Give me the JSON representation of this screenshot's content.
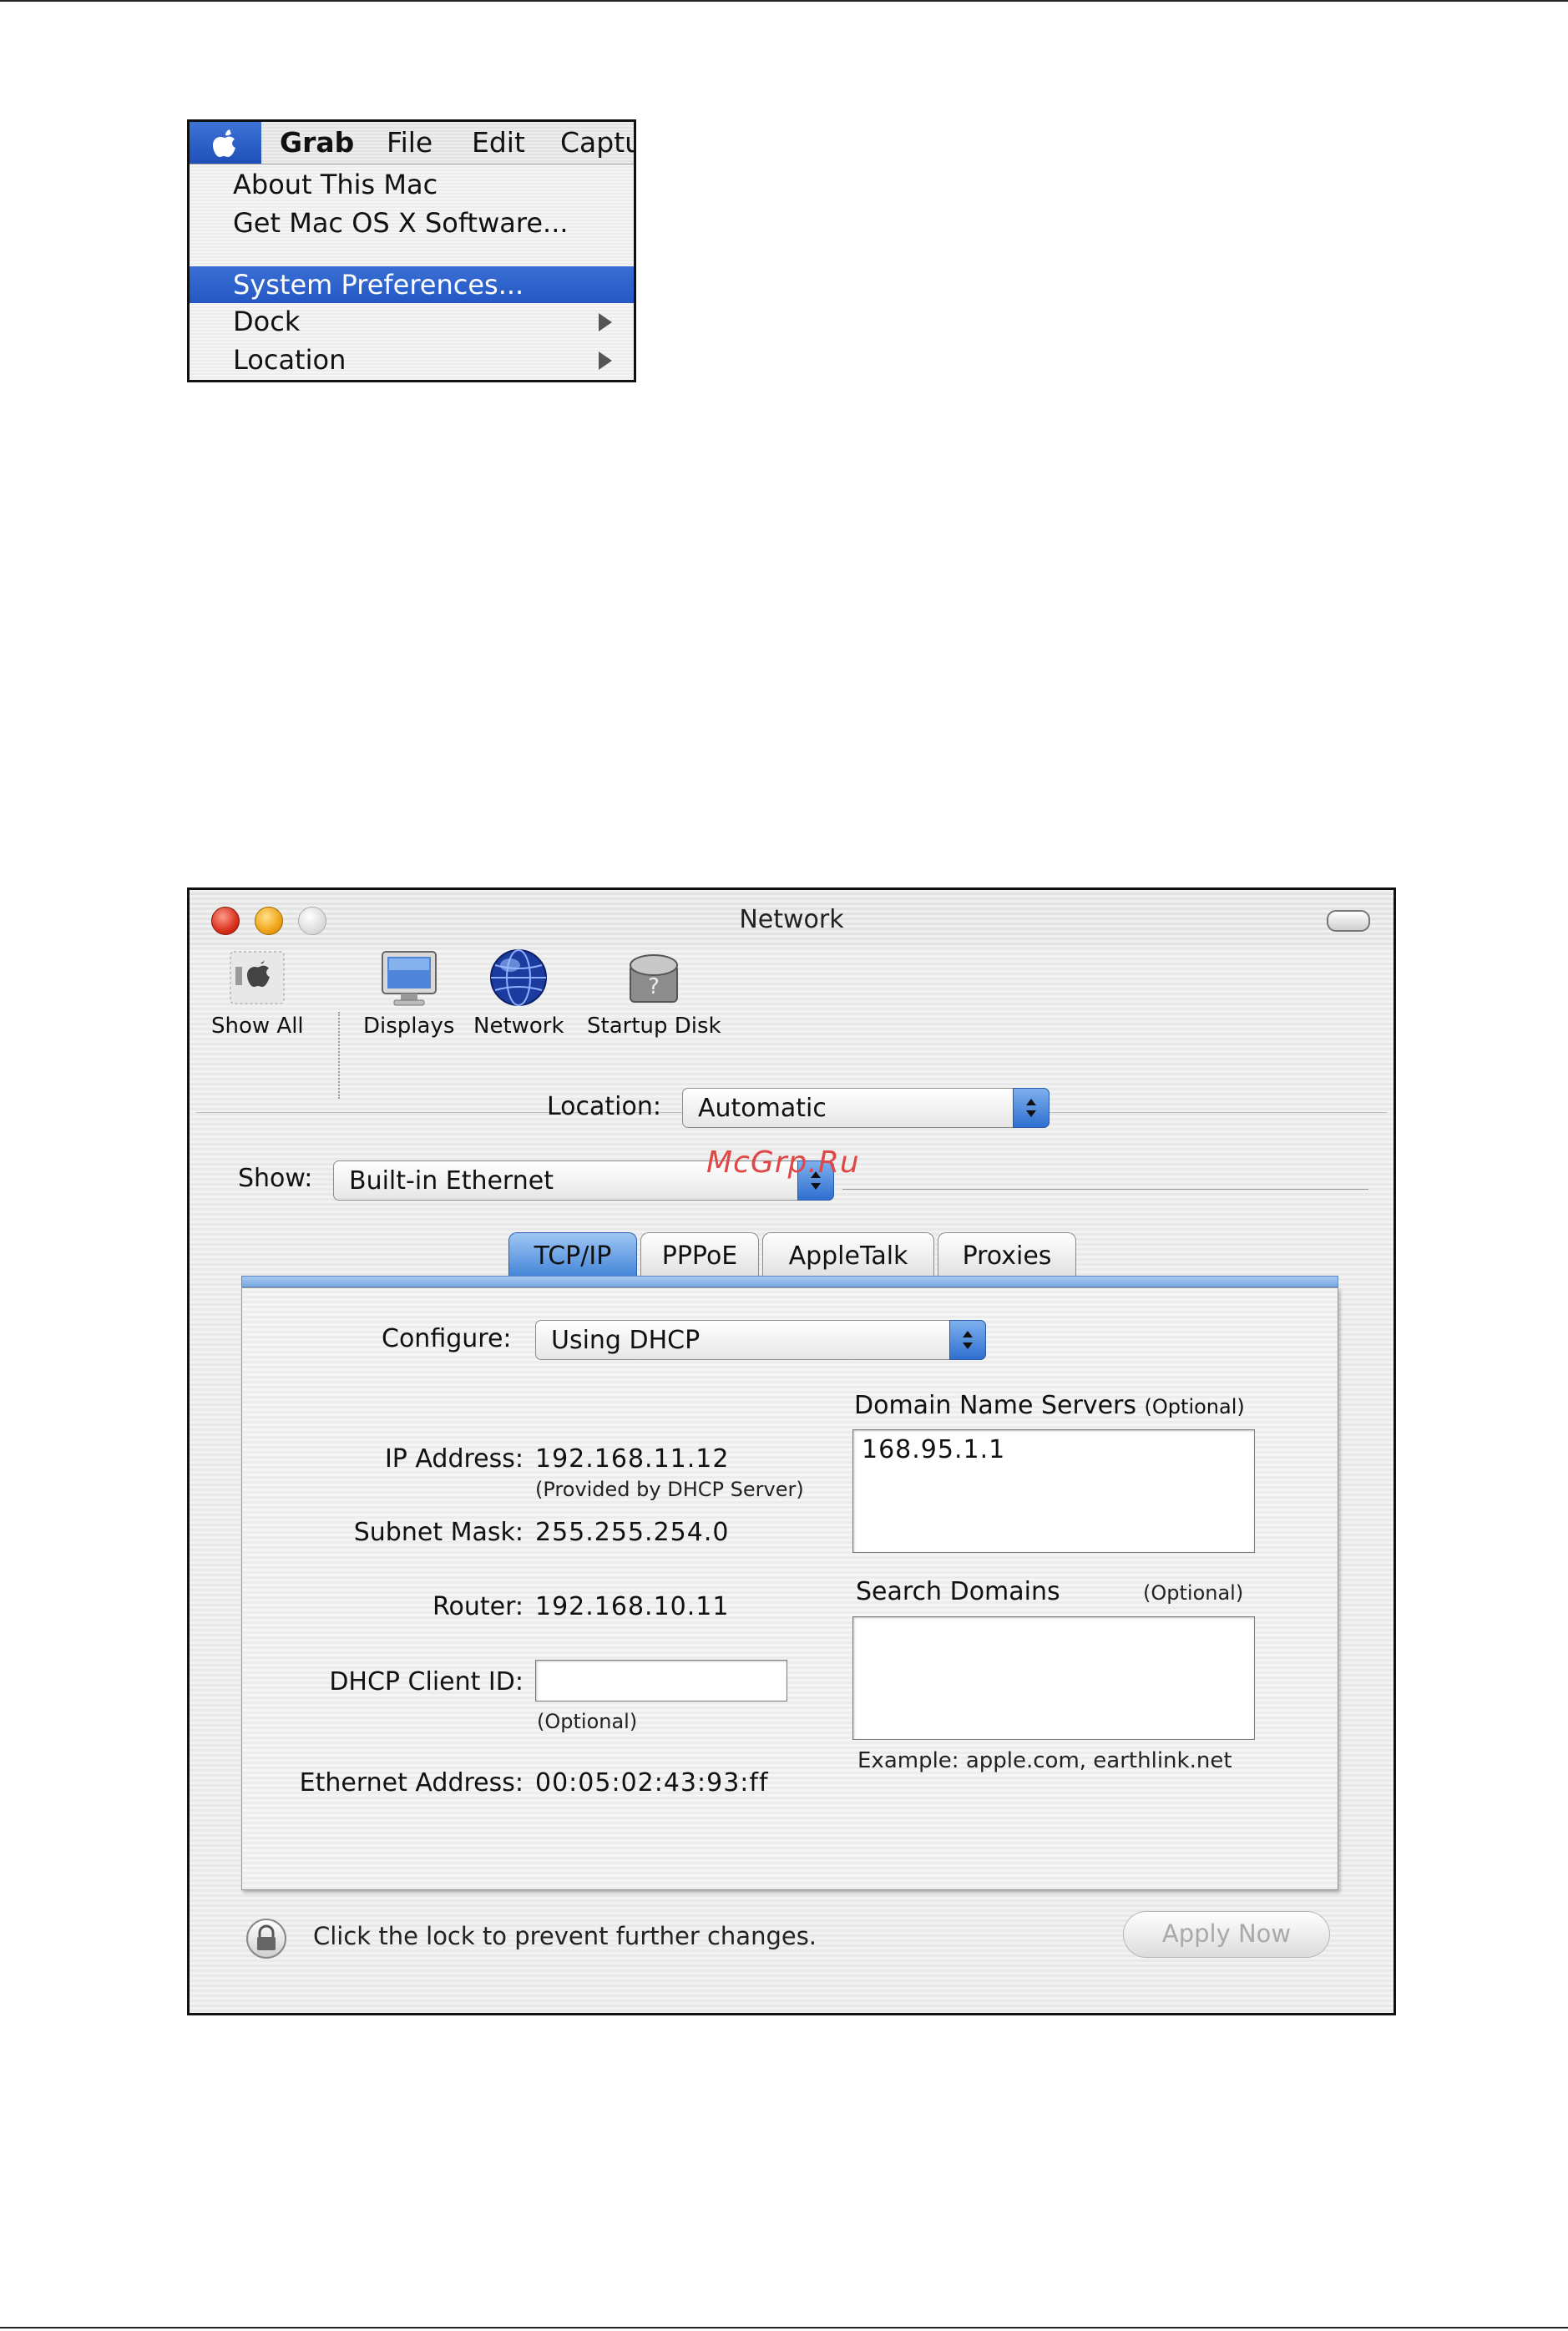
{
  "apple_menu": {
    "menubar": {
      "items": [
        "Grab",
        "File",
        "Edit",
        "Captu"
      ]
    },
    "items": [
      {
        "label": "About This Mac"
      },
      {
        "label": "Get Mac OS X Software..."
      },
      {
        "label": "System Preferences...",
        "selected": true
      },
      {
        "label": "Dock",
        "submenu": true
      },
      {
        "label": "Location",
        "submenu": true
      }
    ]
  },
  "network_window": {
    "title": "Network",
    "toolbar": [
      {
        "label": "Show All",
        "icon": "apple-icon"
      },
      {
        "label": "Displays",
        "icon": "monitor-icon"
      },
      {
        "label": "Network",
        "icon": "globe-icon"
      },
      {
        "label": "Startup Disk",
        "icon": "disk-icon"
      }
    ],
    "location": {
      "label": "Location:",
      "value": "Automatic"
    },
    "show": {
      "label": "Show:",
      "value": "Built-in Ethernet"
    },
    "tabs": [
      {
        "label": "TCP/IP",
        "active": true
      },
      {
        "label": "PPPoE"
      },
      {
        "label": "AppleTalk"
      },
      {
        "label": "Proxies"
      }
    ],
    "configure": {
      "label": "Configure:",
      "value": "Using DHCP"
    },
    "fields": {
      "ip_label": "IP Address:",
      "ip_value": "192.168.11.12",
      "ip_note": "(Provided by DHCP Server)",
      "subnet_label": "Subnet Mask:",
      "subnet_value": "255.255.254.0",
      "router_label": "Router:",
      "router_value": "192.168.10.11",
      "client_id_label": "DHCP Client ID:",
      "client_id_value": "",
      "client_id_note": "(Optional)",
      "ethernet_label": "Ethernet Address:",
      "ethernet_value": "00:05:02:43:93:ff"
    },
    "dns": {
      "title": "Domain Name Servers",
      "optional": "(Optional)",
      "value": "168.95.1.1"
    },
    "search_domains": {
      "title": "Search Domains",
      "optional": "(Optional)",
      "value": "",
      "example": "Example: apple.com, earthlink.net"
    },
    "lock_text": "Click the lock to prevent further changes.",
    "apply_button": "Apply Now"
  },
  "watermark": "McGrp.Ru",
  "colors": {
    "selection_blue": "#2457c4",
    "tab_active_blue": "#3b7fd6",
    "close_red": "#d8301c",
    "minimize_yellow": "#f0a417",
    "watermark_red": "#e04848"
  }
}
